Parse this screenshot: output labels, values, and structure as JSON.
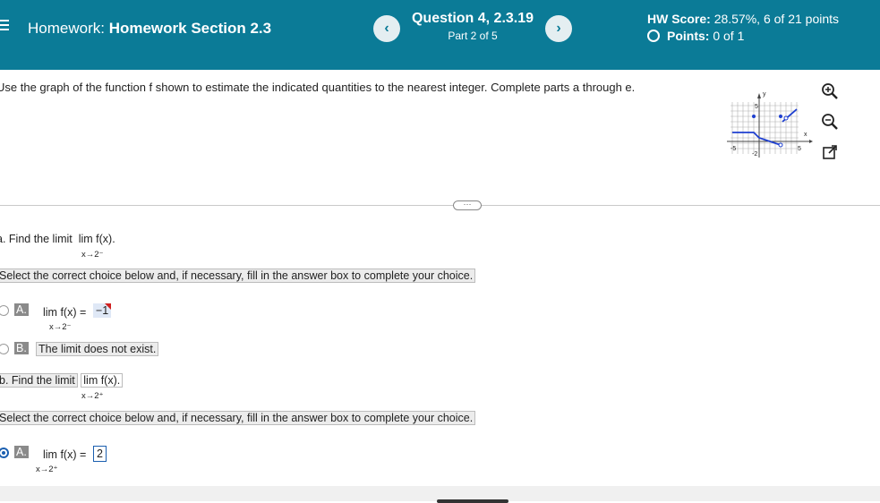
{
  "header": {
    "menu_icon": "hamburger-menu-icon",
    "hw_prefix": "Homework:",
    "hw_name": "Homework Section 2.3",
    "prev_label": "‹",
    "next_label": "›",
    "question_title": "Question 4, 2.3.19",
    "question_part": "Part 2 of 5",
    "score_label": "HW Score:",
    "score_value": "28.57%, 6 of 21 points",
    "points_label": "Points:",
    "points_value": "0 of 1"
  },
  "instructions": "Use the graph of the function f shown to estimate the indicated quantities to the nearest integer. Complete parts a through e.",
  "graph": {
    "y_label": "y",
    "x_label": "x",
    "tick_y": "5",
    "tick_x_neg": "-5",
    "tick_y_neg": "-2",
    "tick_x_pos": "5"
  },
  "tools": {
    "zoom_in": "zoom-in-icon",
    "zoom_out": "zoom-out-icon",
    "popout": "popout-icon"
  },
  "more_label": "···",
  "part_a": {
    "prefix": "a.",
    "text": "Find the limit",
    "expr": "lim f(x).",
    "sub": "x→2⁻",
    "select_text": "Select the correct choice below and, if necessary, fill in the answer box to complete your choice.",
    "choice_a_letter": "A.",
    "choice_a_expr": "lim f(x) =",
    "choice_a_sub": "x→2⁻",
    "choice_a_value": "−1",
    "choice_b_letter": "B.",
    "choice_b_text": "The limit does not exist."
  },
  "part_b": {
    "prefix": "b.",
    "text": "Find the limit",
    "expr": "lim f(x).",
    "sub": "x→2⁺",
    "select_text": "Select the correct choice below and, if necessary, fill in the answer box to complete your choice.",
    "choice_a_letter": "A.",
    "choice_a_expr": "lim f(x) =",
    "choice_a_sub": "x→2⁺",
    "choice_a_value": "2"
  }
}
